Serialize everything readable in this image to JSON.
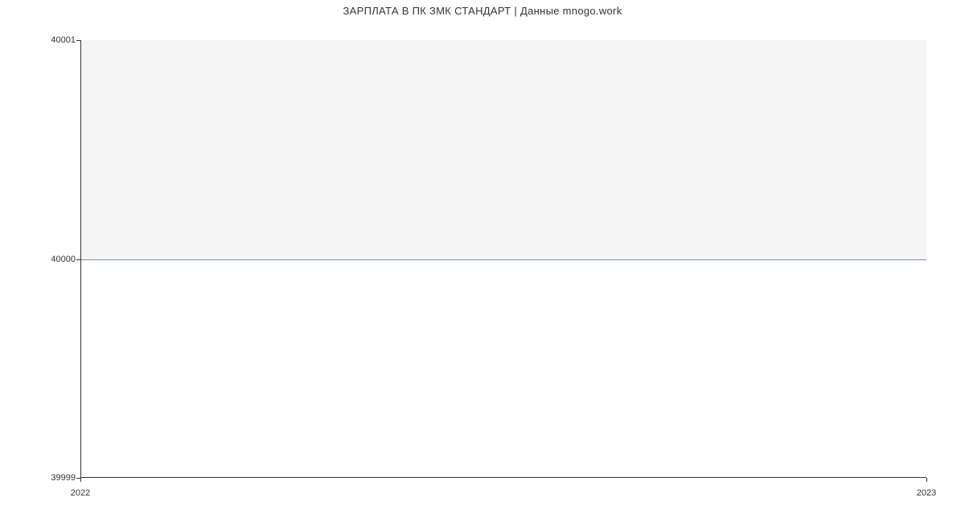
{
  "chart_data": {
    "type": "line",
    "title": "ЗАРПЛАТА В ПК ЗМК СТАНДАРТ | Данные mnogo.work",
    "x": [
      "2022",
      "2023"
    ],
    "values": [
      40000,
      40000
    ],
    "xlabel": "",
    "ylabel": "",
    "ylim": [
      39999,
      40001
    ],
    "y_ticks": [
      "39999",
      "40000",
      "40001"
    ],
    "x_ticks": [
      "2022",
      "2023"
    ],
    "line_color": "#5a9bd4",
    "plot_bg": "#f5f5f5"
  }
}
